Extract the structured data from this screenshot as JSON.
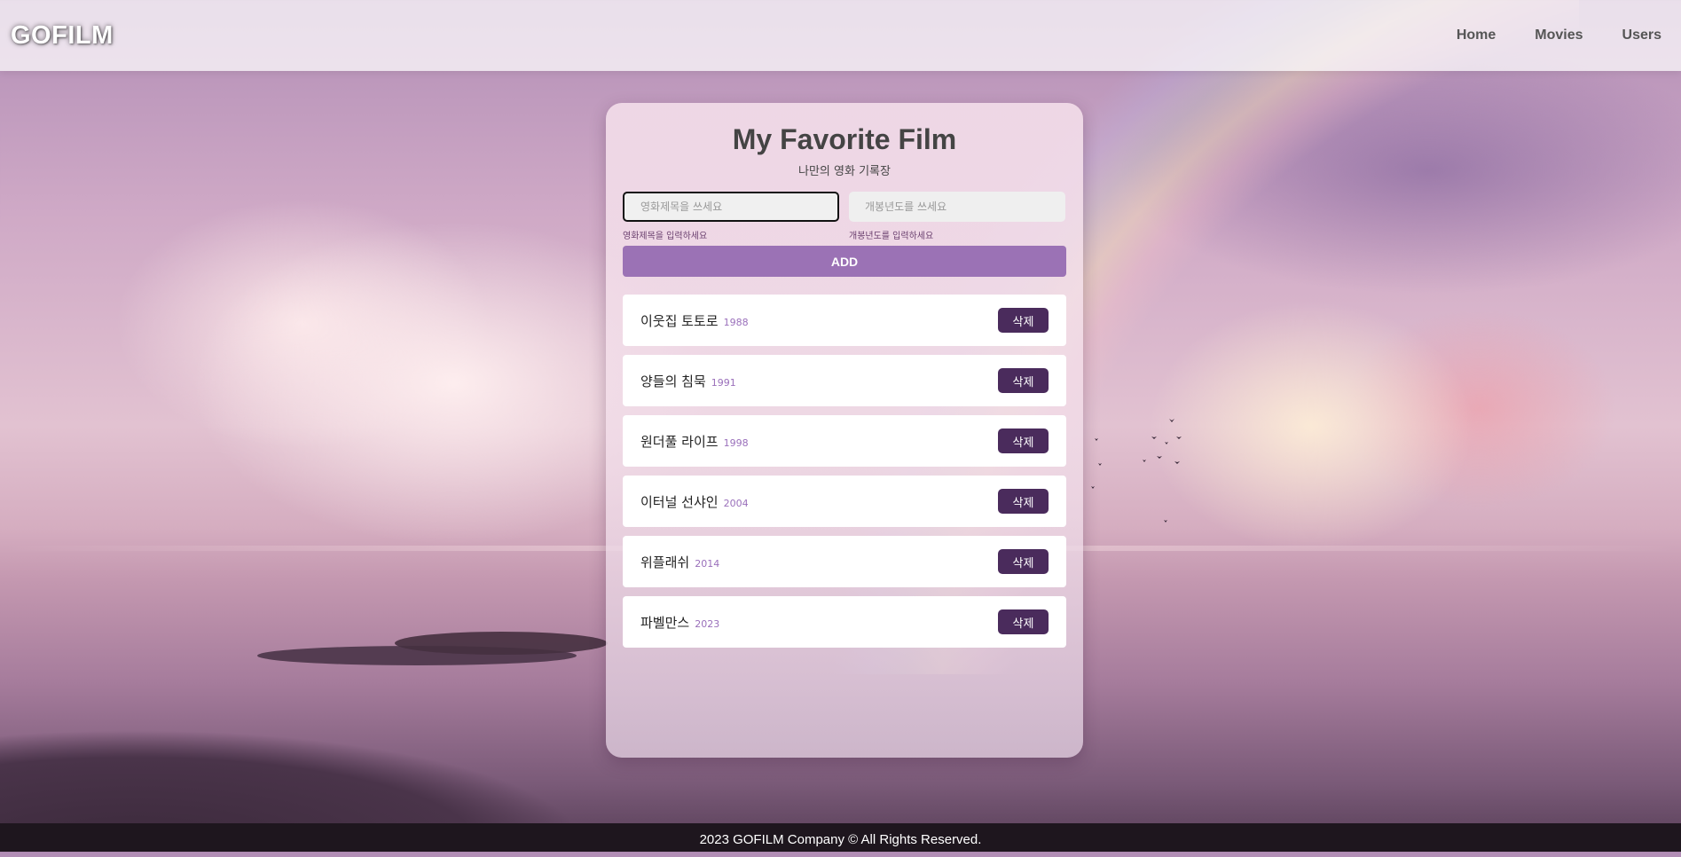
{
  "navbar": {
    "logo": "GOFILM",
    "links": [
      {
        "label": "Home"
      },
      {
        "label": "Movies"
      },
      {
        "label": "Users"
      }
    ]
  },
  "card": {
    "title": "My Favorite Film",
    "subtitle": "나만의 영화 기록장",
    "title_input": {
      "placeholder": "영화제목을 쓰세요",
      "value": "",
      "hint": "영화제목을 입력하세요"
    },
    "year_input": {
      "placeholder": "개봉년도를 쓰세요",
      "value": "",
      "hint": "개봉년도를 입력하세요"
    },
    "add_label": "ADD",
    "movies": [
      {
        "title": "이웃집 토토로",
        "year": "1988",
        "delete_label": "삭제"
      },
      {
        "title": "양들의 침묵",
        "year": "1991",
        "delete_label": "삭제"
      },
      {
        "title": "원더풀 라이프",
        "year": "1998",
        "delete_label": "삭제"
      },
      {
        "title": "이터널 선샤인",
        "year": "2004",
        "delete_label": "삭제"
      },
      {
        "title": "위플래쉬",
        "year": "2014",
        "delete_label": "삭제"
      },
      {
        "title": "파벨만스",
        "year": "2023",
        "delete_label": "삭제"
      }
    ]
  },
  "footer": {
    "text": "2023 GOFILM Company © All Rights Reserved."
  },
  "colors": {
    "accent": "#9b72b5",
    "delete_button": "#4a2b5c",
    "year_text": "#9a70bb",
    "footer_bg": "#1e161e"
  }
}
